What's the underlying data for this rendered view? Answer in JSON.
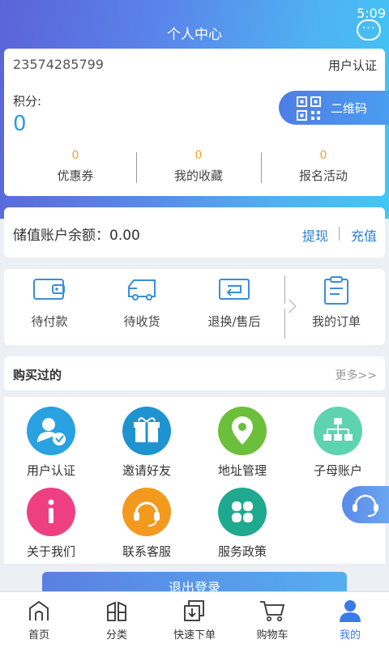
{
  "status_bar": {
    "time": "5:09"
  },
  "header": {
    "title": "个人中心",
    "chat_icon": "chat-bubble-icon"
  },
  "profile": {
    "account_number": "23574285799",
    "verify_label": "用户认证",
    "points_label": "积分:",
    "points_value": "0",
    "qr_label": "二维码",
    "stats": [
      {
        "count": "0",
        "label": "优惠券"
      },
      {
        "count": "0",
        "label": "我的收藏"
      },
      {
        "count": "0",
        "label": "报名活动"
      }
    ]
  },
  "balance": {
    "text": "储值账户余额：0.00",
    "withdraw_label": "提现",
    "topup_label": "充值"
  },
  "orders": {
    "items": [
      {
        "label": "待付款",
        "icon": "wallet-icon"
      },
      {
        "label": "待收货",
        "icon": "truck-icon"
      },
      {
        "label": "退换/售后",
        "icon": "return-box-icon"
      },
      {
        "label": "我的订单",
        "icon": "clipboard-icon"
      }
    ]
  },
  "purchased": {
    "title": "购买过的",
    "more_label": "更多>>"
  },
  "services": [
    {
      "label": "用户认证",
      "color": "#2aa1e0",
      "icon": "user-verify-icon"
    },
    {
      "label": "邀请好友",
      "color": "#1f93d0",
      "icon": "gift-icon"
    },
    {
      "label": "地址管理",
      "color": "#6cbf3a",
      "icon": "location-pin-icon"
    },
    {
      "label": "子母账户",
      "color": "#5ed3b0",
      "icon": "org-chart-icon"
    },
    {
      "label": "关于我们",
      "color": "#ee3f82",
      "icon": "info-icon"
    },
    {
      "label": "联系客服",
      "color": "#f39a1e",
      "icon": "headset-icon"
    },
    {
      "label": "服务政策",
      "color": "#1fa98f",
      "icon": "clover-icon"
    }
  ],
  "logout_label": "退出登录",
  "bottom_nav": [
    {
      "label": "首页",
      "icon": "home-icon"
    },
    {
      "label": "分类",
      "icon": "category-icon"
    },
    {
      "label": "快速下单",
      "icon": "quick-order-icon"
    },
    {
      "label": "购物车",
      "icon": "cart-icon"
    },
    {
      "label": "我的",
      "icon": "profile-icon",
      "active": true
    }
  ],
  "colors": {
    "accent": "#2a9ed8",
    "header_start": "#5b63d8",
    "header_end": "#41c7f4",
    "points_orange": "#f2a22a"
  }
}
